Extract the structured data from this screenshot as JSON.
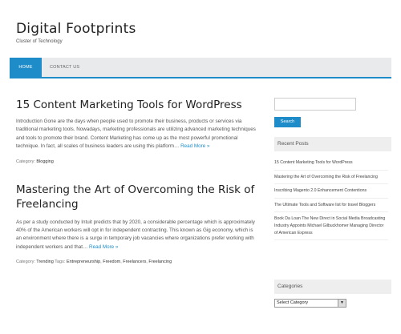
{
  "site": {
    "title": "Digital Footprints",
    "description": "Cluster of Technology"
  },
  "nav": {
    "items": [
      {
        "label": "Home"
      },
      {
        "label": "Contact Us"
      }
    ]
  },
  "posts": [
    {
      "title": "15 Content Marketing Tools for WordPress",
      "excerpt": "Introduction Gone are the days when people used to promote their business, products or services via traditional marketing tools. Nowadays, marketing professionals are utilizing advanced marketing techniques and tools to promote their brand. Content Marketing has come up as the most powerful promotional technique. In fact, all scales of business leaders are using this platform…",
      "read_more": "Read More »",
      "meta_label": "Category:",
      "category": "Blogging"
    },
    {
      "title": "Mastering the Art of Overcoming the Risk of Freelancing",
      "excerpt": "As per a study conducted by Intuit predicts that by 2020, a considerable percentage which is approximately 40% of the American workers will opt in for independent contracting. This known as Gig economy, which is an environment where there is a surge in temporary job vacancies where organizations prefer working with independent workers and that…",
      "read_more": "Read More »",
      "meta_label": "Category:",
      "category": "Trending",
      "tags_label": "Tags:",
      "tags": [
        "Entrepreneurship",
        "Freedom",
        "Freelancers",
        "Freelancing"
      ]
    }
  ],
  "sidebar": {
    "search": {
      "value": "",
      "button_label": "Search"
    },
    "recent_posts": {
      "title": "Recent Posts",
      "items": [
        "15 Content Marketing Tools for WordPress",
        "Mastering the Art of Overcoming the Risk of Freelancing",
        "Inscribing Magento 2.0 Enhancement Contentions",
        "The Ultimate Tools and Software list for travel Bloggers",
        "Book Da Loan The New Direct in Social Media Broadcasting Industry Appoints Michael Gilbuckhomer Managing Director of American Express"
      ]
    },
    "categories": {
      "title": "Categories",
      "selected": "Select Category"
    }
  },
  "colors": {
    "accent": "#1e8cc8",
    "nav_bg": "#e9eaeb"
  }
}
